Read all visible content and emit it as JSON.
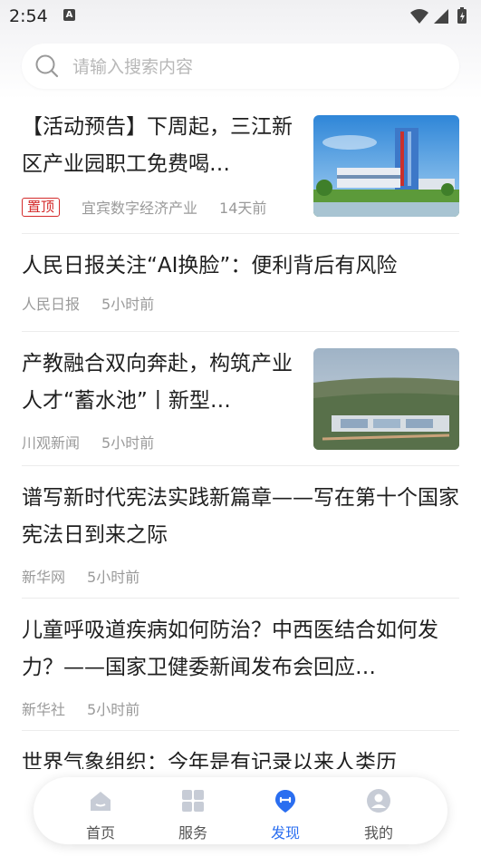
{
  "status_bar": {
    "time": "2:54",
    "notification_letter": "A"
  },
  "search": {
    "placeholder": "请输入搜索内容"
  },
  "feed": [
    {
      "title": "【活动预告】下周起，三江新区产业园职工免费喝…",
      "pinned_label": "置顶",
      "source": "宜宾数字经济产业",
      "time": "14天前",
      "thumbnail": "city-building-photo"
    },
    {
      "title": "人民日报关注“AI换脸”：便利背后有风险",
      "source": "人民日报",
      "time": "5小时前"
    },
    {
      "title": "产教融合双向奔赴，构筑产业人才“蓄水池”丨新型…",
      "source": "川观新闻",
      "time": "5小时前",
      "thumbnail": "aerial-town-photo"
    },
    {
      "title": "谱写新时代宪法实践新篇章——写在第十个国家宪法日到来之际",
      "source": "新华网",
      "time": "5小时前"
    },
    {
      "title": "儿童呼吸道疾病如何防治？中西医结合如何发力？——国家卫健委新闻发布会回应…",
      "source": "新华社",
      "time": "5小时前"
    },
    {
      "title": "世界气象组织：今年是有记录以来人类历"
    }
  ],
  "tabbar": [
    {
      "label": "首页",
      "icon": "home-icon"
    },
    {
      "label": "服务",
      "icon": "grid-icon"
    },
    {
      "label": "发现",
      "icon": "discover-icon",
      "active": true
    },
    {
      "label": "我的",
      "icon": "profile-icon"
    }
  ],
  "colors": {
    "accent": "#2a6ef0",
    "pin": "#d42b2b"
  }
}
